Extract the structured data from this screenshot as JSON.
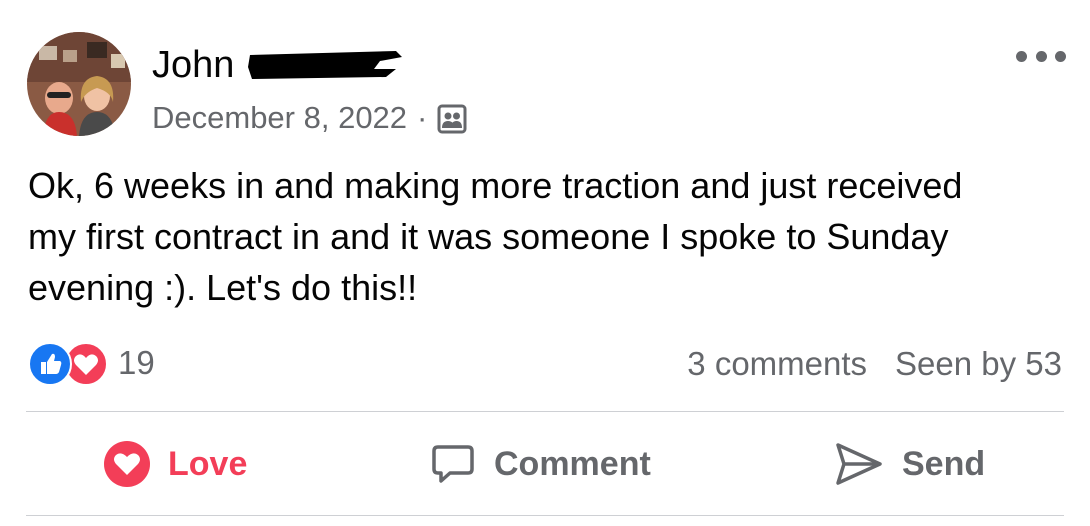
{
  "post": {
    "author_name": "John",
    "date": "December 8, 2022",
    "separator": "·",
    "audience_icon": "group-audience-icon",
    "more_icon": "more-options-icon",
    "text": "Ok, 6 weeks in and making more traction and just received\nmy first contract in and it was someone I spoke to Sunday\nevening :).  Let's do this!!"
  },
  "stats": {
    "reaction_icons": [
      "like-reaction-icon",
      "love-reaction-icon"
    ],
    "reaction_count": "19",
    "comments": "3 comments",
    "seen_by": "Seen by 53"
  },
  "actions": {
    "love_label": "Love",
    "comment_label": "Comment",
    "send_label": "Send"
  },
  "colors": {
    "love_red": "#f33e58",
    "like_blue": "#1877f2",
    "secondary_text": "#65676b",
    "divider": "#ced0d4"
  }
}
